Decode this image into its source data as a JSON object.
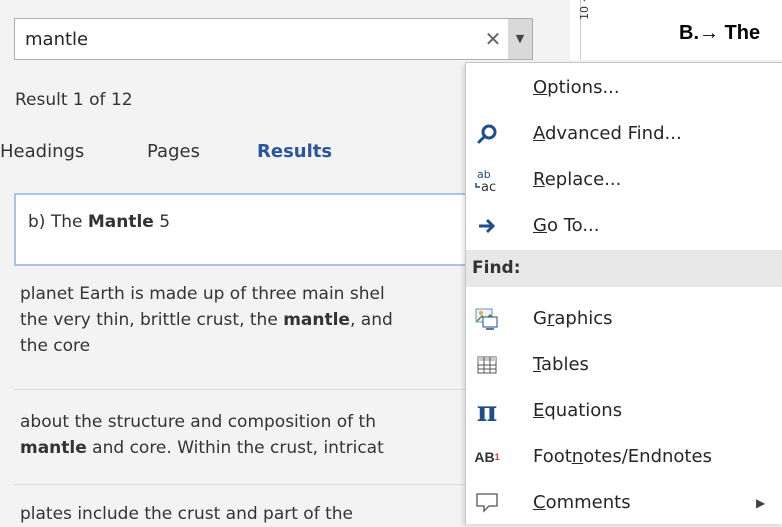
{
  "search": {
    "value": "mantle",
    "clear_icon": "close-icon",
    "dropdown_icon": "dropdown-arrow-icon"
  },
  "nav": {
    "result_count": "Result 1 of 12",
    "tabs": [
      {
        "label": "Headings"
      },
      {
        "label": "Pages"
      },
      {
        "label": "Results",
        "active": true
      }
    ],
    "results": [
      {
        "before": "b) The ",
        "match": "Mantle",
        "after": " 5"
      },
      {
        "before": "planet Earth is made up of three main shel",
        "line2_before": "the very thin, brittle crust, the ",
        "match": "mantle",
        "line2_after": ", and",
        "line3": "the core"
      },
      {
        "before": "about the structure and composition of th",
        "match": "mantle",
        "after": " and core. Within the crust, intricat"
      },
      {
        "before": "plates include the crust and part of the"
      }
    ]
  },
  "document": {
    "ruler_mark": "10 ·",
    "heading": "B.→ The"
  },
  "menu": {
    "items": [
      {
        "label": "Options...",
        "accel": "O",
        "icon": ""
      },
      {
        "label": "Advanced Find...",
        "accel": "A",
        "icon": "search-icon"
      },
      {
        "label": "Replace...",
        "accel": "R",
        "icon": "replace-icon"
      },
      {
        "label": "Go To...",
        "accel": "G",
        "icon": "arrow-right-icon"
      }
    ],
    "find_header": "Find:",
    "find_items": [
      {
        "label": "Graphics",
        "accel": "r",
        "icon": "graphics-icon"
      },
      {
        "label": "Tables",
        "accel": "T",
        "icon": "table-icon"
      },
      {
        "label": "Equations",
        "accel": "E",
        "icon": "pi-icon"
      },
      {
        "label": "Footnotes/Endnotes",
        "accel": "n",
        "icon": "footnote-icon"
      },
      {
        "label": "Comments",
        "accel": "C",
        "icon": "comment-icon",
        "submenu": true
      }
    ]
  },
  "colors": {
    "accent": "#2b579a",
    "icon_blue": "#1e4e8c"
  }
}
